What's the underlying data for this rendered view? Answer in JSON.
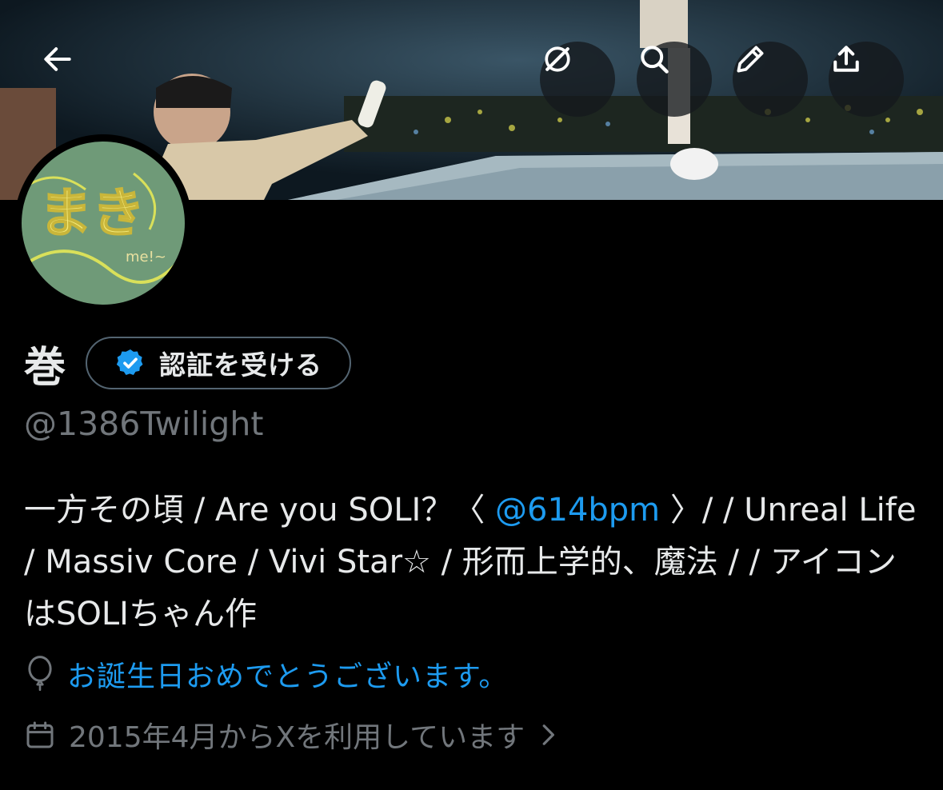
{
  "header": {
    "back_icon": "arrow-left-icon",
    "actions": [
      {
        "icon": "grok-icon"
      },
      {
        "icon": "search-icon"
      },
      {
        "icon": "edit-pencil-icon"
      },
      {
        "icon": "share-icon"
      }
    ]
  },
  "avatar": {
    "text_main": "まき",
    "text_small": "me!~"
  },
  "profile": {
    "display_name": "巻",
    "verify_label": "認証を受ける",
    "handle": "@1386Twilight"
  },
  "bio": {
    "part1": "一方その頃 / Are you SOLI？〈 ",
    "mention": "@614bpm",
    "part2": " 〉/ / Unreal Life / Massiv Core / Vivi Star☆ / 形而上学的、魔法 / / アイコンはSOLIちゃん作"
  },
  "birthday": {
    "icon": "balloon-icon",
    "text": "お誕生日おめでとうございます。"
  },
  "joined": {
    "icon": "calendar-icon",
    "text": "2015年4月からXを利用しています"
  },
  "colors": {
    "accent": "#1d9bf0",
    "muted": "#71767b",
    "background": "#000000"
  }
}
